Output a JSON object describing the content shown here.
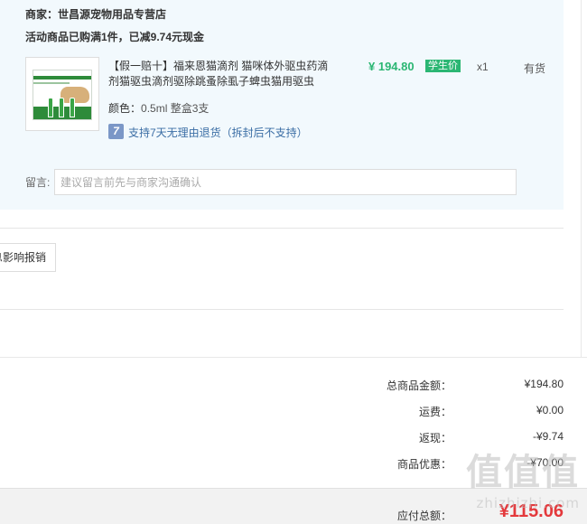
{
  "order": {
    "seller_label": "商家：世昌源宠物用品专营店",
    "promo_text": "活动商品已购满1件，已减9.74元现金",
    "item": {
      "title": "【假一赔十】福来恩猫滴剂 猫咪体外驱虫药滴剂猫驱虫滴剂驱除跳蚤除虱子蜱虫猫用驱虫",
      "price": "¥ 194.80",
      "badge": "学生价",
      "quantity": "x1",
      "stock_status": "有货",
      "attr_label": "颜色：",
      "attr_value": "0.5ml 整盒3支",
      "return_icon": "7",
      "return_policy": "支持7天无理由退货（拆封后不支持）"
    },
    "message": {
      "label": "留言:",
      "placeholder": "建议留言前先与商家沟通确认"
    }
  },
  "invoice_button_label": "息影响报销",
  "summary": {
    "rows": [
      {
        "label": "总商品金额：",
        "value": "¥194.80"
      },
      {
        "label": "运费：",
        "value": "¥0.00"
      },
      {
        "label": "返现：",
        "value": "-¥9.74"
      },
      {
        "label": "商品优惠：",
        "value": "-¥70.00"
      }
    ],
    "total_label": "应付总额：",
    "total_value": "¥115.06"
  },
  "watermark": {
    "logo_text": "值值值",
    "site_text": "zhizhizhi.com"
  },
  "colors": {
    "card_bg": "#f2f9fd",
    "price_green": "#2bb673",
    "total_red": "#e4393c",
    "return_blue": "#3b6ea5"
  }
}
